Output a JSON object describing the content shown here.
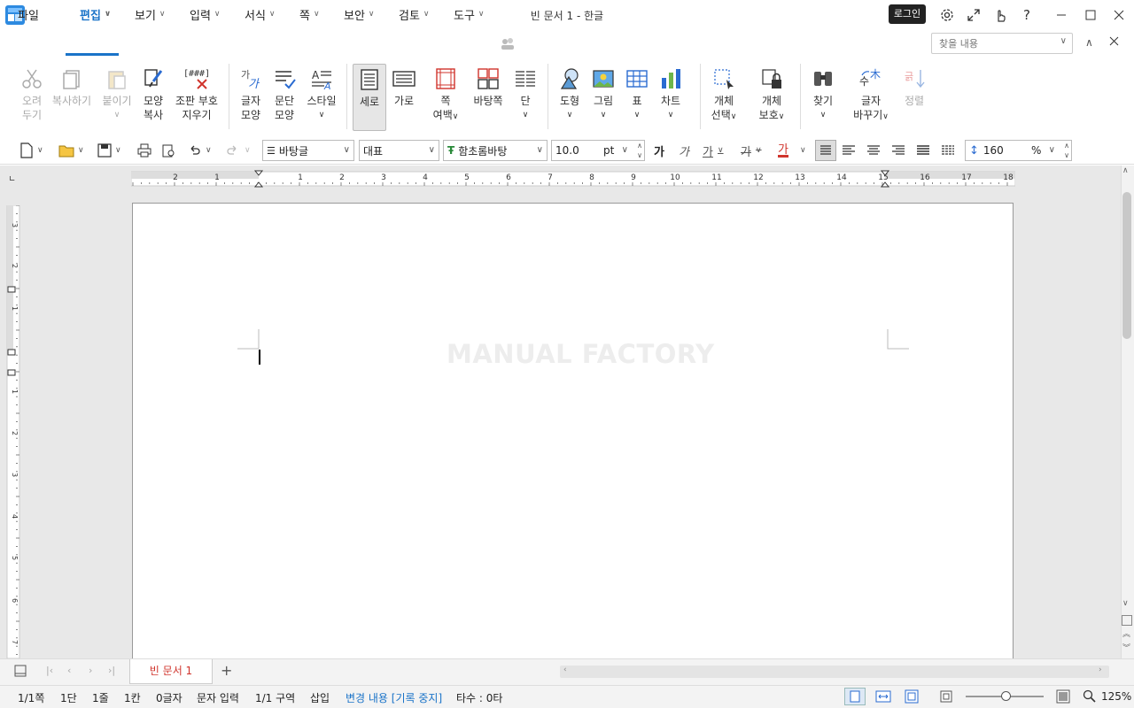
{
  "window": {
    "title": "빈 문서 1 - 한글",
    "login_label": "로그인"
  },
  "menu": {
    "file": "파일",
    "tabs": [
      "편집",
      "보기",
      "입력",
      "서식",
      "쪽",
      "보안",
      "검토",
      "도구"
    ],
    "active_tab": "편집",
    "search_placeholder": "찾을 내용"
  },
  "ribbon": {
    "cut": [
      "오려",
      "두기"
    ],
    "copy": "복사하기",
    "paste": "붙이기",
    "format_copy": [
      "모양",
      "복사"
    ],
    "clear_marks": [
      "조판 부호",
      "지우기"
    ],
    "char_shape": [
      "글자",
      "모양"
    ],
    "para_shape": [
      "문단",
      "모양"
    ],
    "style": "스타일",
    "vertical": "세로",
    "horizontal": "가로",
    "page_margin": [
      "쪽",
      "여백"
    ],
    "master_page": "바탕쪽",
    "columns": "단",
    "shape": "도형",
    "picture": "그림",
    "table": "표",
    "chart": "차트",
    "object_select": [
      "개체",
      "선택"
    ],
    "object_protect": [
      "개체",
      "보호"
    ],
    "find": "찾기",
    "replace": [
      "글자",
      "바꾸기"
    ],
    "sort": "정렬",
    "clear_marks_icon_text": "[###]"
  },
  "format_bar": {
    "style_name": "바탕글",
    "font_lang": "대표",
    "font_name": "함초롬바탕",
    "font_size": "10.0",
    "font_unit": "pt",
    "line_spacing": "160",
    "line_spacing_unit": "%"
  },
  "ruler": {
    "h_labels": [
      "2",
      "1",
      "1",
      "2",
      "3",
      "4",
      "5",
      "6",
      "7",
      "8",
      "9",
      "10",
      "11",
      "12",
      "13",
      "14",
      "15",
      "16",
      "17",
      "18"
    ],
    "v_labels": [
      "3",
      "2",
      "1",
      "1",
      "2",
      "3",
      "4",
      "5",
      "6",
      "7"
    ]
  },
  "document": {
    "watermark": "MANUAL FACTORY"
  },
  "doc_tabs": {
    "active": "빈 문서 1",
    "add_label": "+"
  },
  "status": {
    "page": "1/1쪽",
    "column": "1단",
    "line": "1줄",
    "char_col": "1칸",
    "char_count": "0글자",
    "input_mode": "문자 입력",
    "section": "1/1 구역",
    "insert_mode": "삽입",
    "track_changes": "변경 내용 [기록 중지]",
    "typing": "타수 : 0타",
    "zoom": "125%"
  },
  "colors": {
    "accent": "#1a73c8",
    "doc_tab_text": "#d0342c"
  }
}
